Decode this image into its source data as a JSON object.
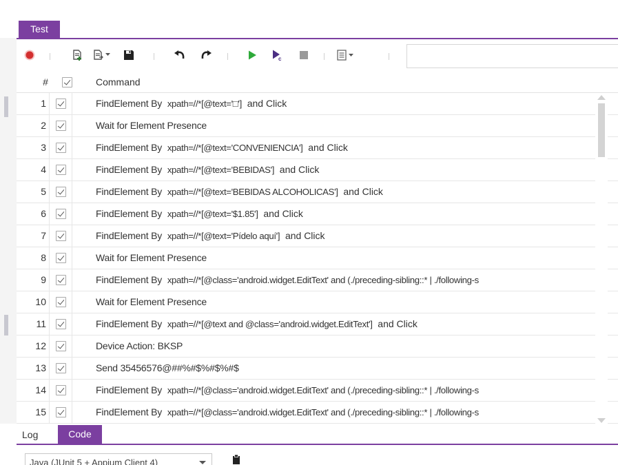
{
  "tabs": {
    "test": "Test"
  },
  "toolbar": {
    "icons": [
      "record-icon",
      "new-step-icon",
      "add-step-dropdown-icon",
      "save-icon",
      "undo-icon",
      "redo-icon",
      "run-icon",
      "run-from-cursor-icon",
      "stop-icon",
      "format-menu-icon"
    ],
    "search_value": ""
  },
  "table": {
    "headers": {
      "num": "#",
      "command": "Command"
    },
    "rows": [
      {
        "num": "1",
        "kw": "FindElement By",
        "xp": "xpath=//*[@text='□']",
        "tail": "and Click"
      },
      {
        "num": "2",
        "kw": "Wait for Element Presence",
        "xp": "",
        "tail": ""
      },
      {
        "num": "3",
        "kw": "FindElement By",
        "xp": "xpath=//*[@text='CONVENIENCIA']",
        "tail": "and Click"
      },
      {
        "num": "4",
        "kw": "FindElement By",
        "xp": "xpath=//*[@text='BEBIDAS']",
        "tail": "and Click"
      },
      {
        "num": "5",
        "kw": "FindElement By",
        "xp": "xpath=//*[@text='BEBIDAS ALCOHOLICAS']",
        "tail": "and Click"
      },
      {
        "num": "6",
        "kw": "FindElement By",
        "xp": "xpath=//*[@text='$1.85']",
        "tail": "and Click"
      },
      {
        "num": "7",
        "kw": "FindElement By",
        "xp": "xpath=//*[@text='Pídelo aquí']",
        "tail": "and Click"
      },
      {
        "num": "8",
        "kw": "Wait for Element Presence",
        "xp": "",
        "tail": ""
      },
      {
        "num": "9",
        "kw": "FindElement By",
        "xp": "xpath=//*[@class='android.widget.EditText' and (./preceding-sibling::* | ./following-s",
        "tail": ""
      },
      {
        "num": "10",
        "kw": "Wait for Element Presence",
        "xp": "",
        "tail": ""
      },
      {
        "num": "11",
        "kw": "FindElement By",
        "xp": "xpath=//*[@text and @class='android.widget.EditText']",
        "tail": "and Click"
      },
      {
        "num": "12",
        "kw": "Device Action:  BKSP",
        "xp": "",
        "tail": ""
      },
      {
        "num": "13",
        "kw": "Send  35456576@##%#$%#$%#$",
        "xp": "",
        "tail": ""
      },
      {
        "num": "14",
        "kw": "FindElement By",
        "xp": "xpath=//*[@class='android.widget.EditText' and (./preceding-sibling::* | ./following-s",
        "tail": ""
      },
      {
        "num": "15",
        "kw": "FindElement By",
        "xp": "xpath=//*[@class='android.widget.EditText' and (./preceding-sibling::* | ./following-s",
        "tail": ""
      }
    ]
  },
  "bottom_tabs": {
    "log": "Log",
    "code": "Code"
  },
  "code": {
    "language": "Java (JUnit 5 + Appium Client 4)"
  },
  "colors": {
    "accent": "#7b3fa0",
    "run": "#2eaa3a",
    "record": "#d32f2f"
  }
}
